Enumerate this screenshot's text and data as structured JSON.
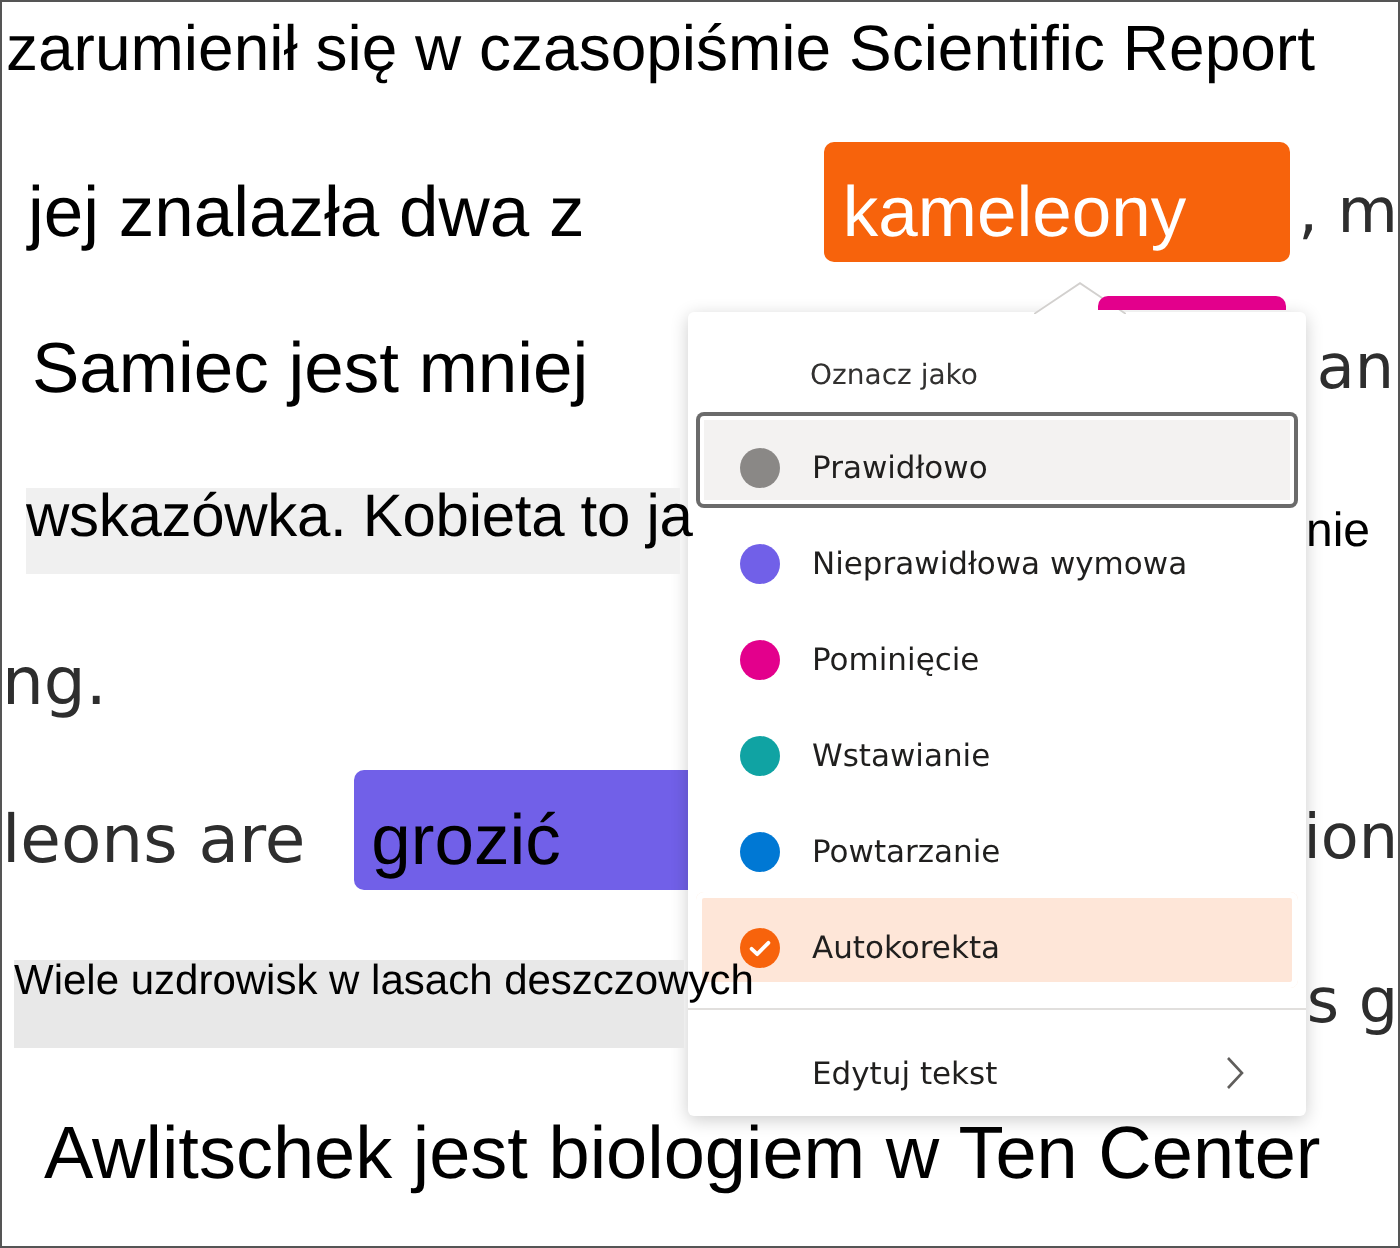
{
  "lines": [
    {
      "segments": [
        {
          "kind": "text",
          "text": "zarumienił się w czasopiśmie Scientific Report"
        }
      ]
    },
    {
      "segments": [
        {
          "kind": "text",
          "text": "jej znalazła dwa z"
        },
        {
          "kind": "chip",
          "text": "kameleony",
          "color": "#f7630c",
          "active": true
        },
        {
          "kind": "faint",
          "text": ", m"
        }
      ]
    },
    {
      "segments": [
        {
          "kind": "text",
          "text": "Samiec jest mniej"
        },
        {
          "kind": "bar",
          "color": "#e3008c"
        },
        {
          "kind": "faint",
          "text": "an"
        }
      ]
    },
    {
      "segments": [
        {
          "kind": "shaded",
          "text": "wskazówka. Kobieta to ja"
        },
        {
          "kind": "small",
          "text": "nie"
        }
      ]
    },
    {
      "segments": [
        {
          "kind": "faint",
          "text": "ng."
        }
      ]
    },
    {
      "segments": [
        {
          "kind": "faint",
          "text": "leons are"
        },
        {
          "kind": "chip",
          "text": "grozić",
          "color": "#7160e8",
          "active": false
        },
        {
          "kind": "faint",
          "text": "ion"
        }
      ]
    },
    {
      "segments": [
        {
          "kind": "caption",
          "text": "Wiele uzdrowisk w lasach deszczowych"
        },
        {
          "kind": "faint",
          "text": "s g"
        }
      ]
    },
    {
      "segments": [
        {
          "kind": "text",
          "text": "Awlitschek jest biologiem w Ten Center"
        }
      ]
    }
  ],
  "menu": {
    "header": "Oznacz jako",
    "options": [
      {
        "label": "Prawidłowo",
        "color": "#8a8886",
        "focused": true,
        "selected": false
      },
      {
        "label": "Nieprawidłowa wymowa",
        "color": "#7160e8",
        "focused": false,
        "selected": false
      },
      {
        "label": "Pominięcie",
        "color": "#e3008c",
        "focused": false,
        "selected": false
      },
      {
        "label": "Wstawianie",
        "color": "#10a3a3",
        "focused": false,
        "selected": false
      },
      {
        "label": "Powtarzanie",
        "color": "#0078d4",
        "focused": false,
        "selected": false
      },
      {
        "label": "Autokorekta",
        "color": "#f7630c",
        "focused": false,
        "selected": true
      }
    ],
    "edit_item": {
      "label": "Edytuj tekst"
    }
  }
}
